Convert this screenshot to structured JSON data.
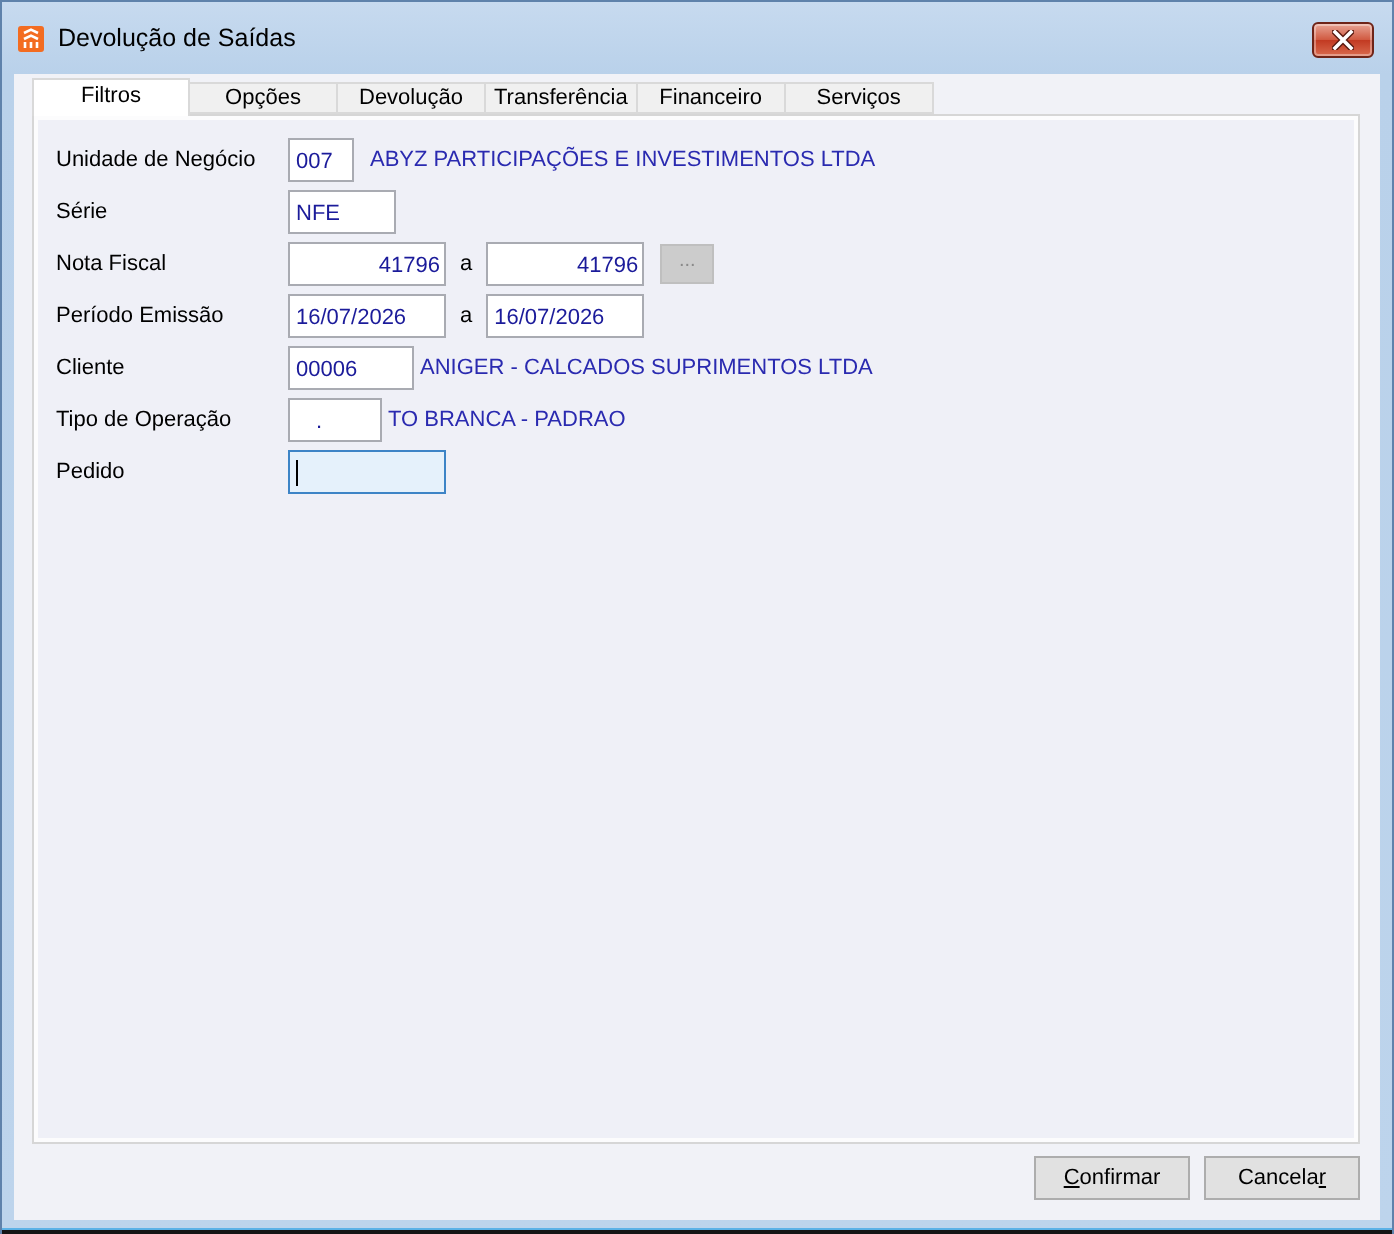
{
  "window": {
    "title": "Devolução de Saídas"
  },
  "tabs": [
    {
      "label": "Filtros",
      "selected": true
    },
    {
      "label": "Opções",
      "selected": false
    },
    {
      "label": "Devolução",
      "selected": false
    },
    {
      "label": "Transferência",
      "selected": false
    },
    {
      "label": "Financeiro",
      "selected": false
    },
    {
      "label": "Serviços",
      "selected": false
    }
  ],
  "form": {
    "rows": [
      {
        "kind": "lookup",
        "label": "Unidade de Negócio",
        "code": "007",
        "description": "ABYZ PARTICIPAÇÕES E INVESTIMENTOS LTDA",
        "focused": false
      },
      {
        "kind": "text",
        "label": "Série",
        "value": "NFE",
        "focused": false
      },
      {
        "kind": "number_range",
        "label": "Nota Fiscal",
        "from": "41796",
        "separator": "a",
        "to": "41796",
        "focused": false,
        "button": {
          "label": "...",
          "disabled": true
        }
      },
      {
        "kind": "date_range",
        "label": "Período Emissão",
        "from": "16/07/2026",
        "separator": "a",
        "to": "16/07/2026",
        "focused": false
      },
      {
        "kind": "lookup",
        "label": "Cliente",
        "code": "00006",
        "description": "ANIGER - CALCADOS SUPRIMENTOS LTDA",
        "focused": false
      },
      {
        "kind": "lookup",
        "label": "Tipo de Operação",
        "code": ".",
        "description": "TO BRANCA - PADRAO",
        "focused": false
      },
      {
        "kind": "text",
        "label": "Pedido",
        "focused": true
      }
    ]
  },
  "buttons": [
    {
      "label_parts": [
        {
          "text": "C",
          "underlined": true
        },
        {
          "text": "onfirmar",
          "underlined": false
        }
      ]
    },
    {
      "label_parts": [
        {
          "text": "Cancela",
          "underlined": false
        },
        {
          "text": "r",
          "underlined": true
        }
      ]
    }
  ]
}
